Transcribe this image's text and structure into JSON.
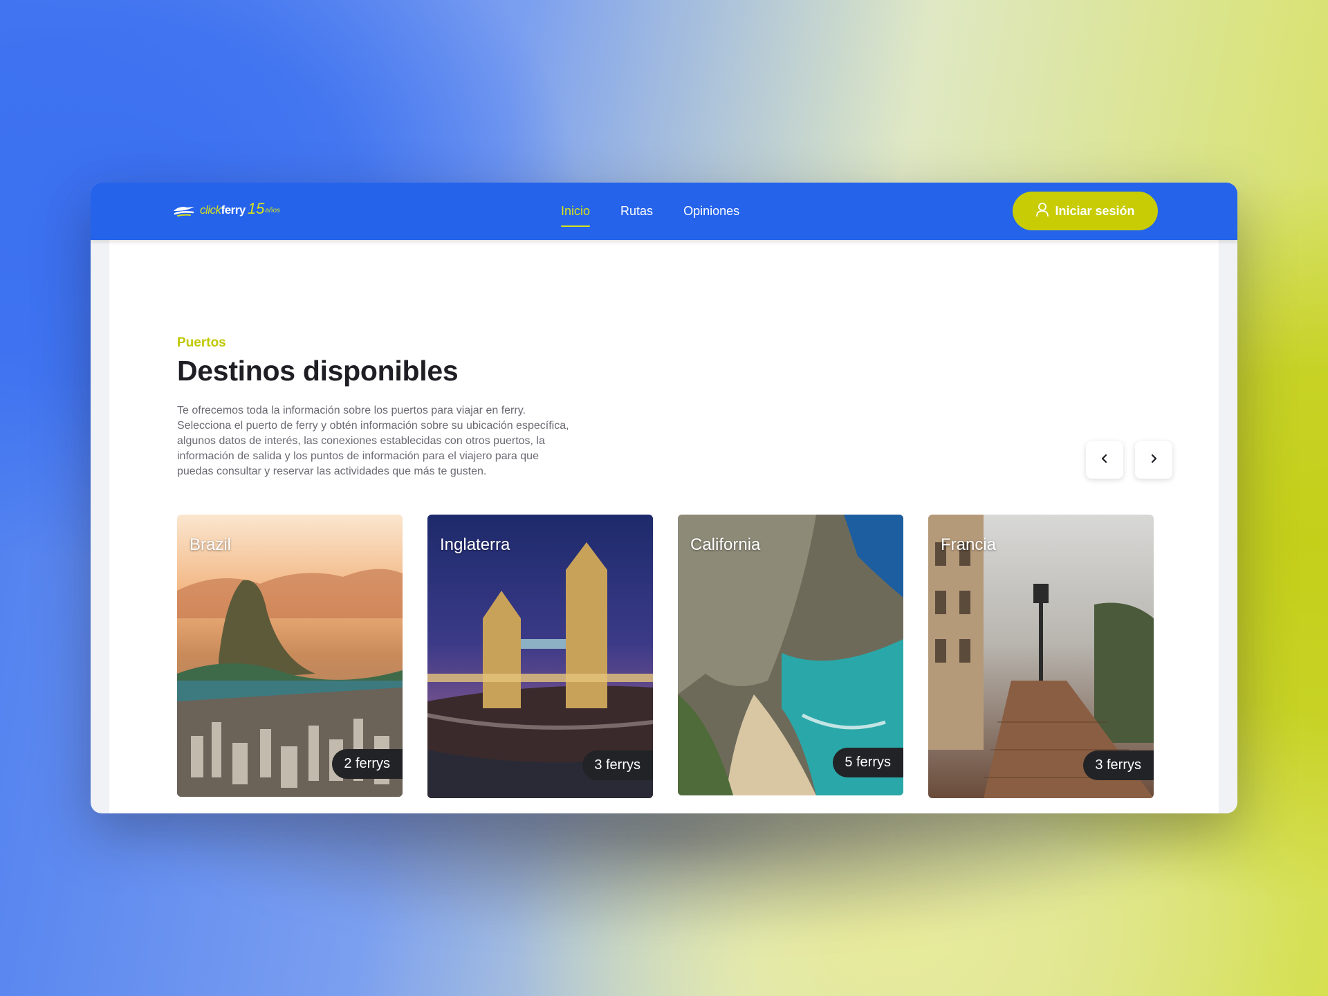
{
  "brand": {
    "logo_click": "click",
    "logo_ferry": "ferry",
    "logo_years": "15",
    "logo_years_word": "años"
  },
  "nav": {
    "items": [
      {
        "label": "Inicio",
        "active": true
      },
      {
        "label": "Rutas",
        "active": false
      },
      {
        "label": "Opiniones",
        "active": false
      }
    ],
    "login_label": "Iniciar sesión"
  },
  "section": {
    "eyebrow": "Puertos",
    "title": "Destinos disponibles",
    "description": "Te ofrecemos toda la información sobre los puertos para viajar en ferry. Selecciona el puerto de ferry y obtén información sobre su ubicación específica, algunos datos de interés, las conexiones establecidas con otros puertos, la información de salida y los puntos de información para el viajero para que puedas consultar y reservar las actividades que más te gusten."
  },
  "destinations": [
    {
      "name": "Brazil",
      "ferries": "2 ferrys"
    },
    {
      "name": "Inglaterra",
      "ferries": "3 ferrys"
    },
    {
      "name": "California",
      "ferries": "5 ferrys"
    },
    {
      "name": "Francia",
      "ferries": "3 ferrys"
    }
  ],
  "colors": {
    "nav": "#2563eb",
    "accent": "#c7cc05",
    "title": "#1e1e24"
  },
  "icons": {
    "prev": "chevron-left-icon",
    "next": "chevron-right-icon",
    "user": "user-icon"
  }
}
